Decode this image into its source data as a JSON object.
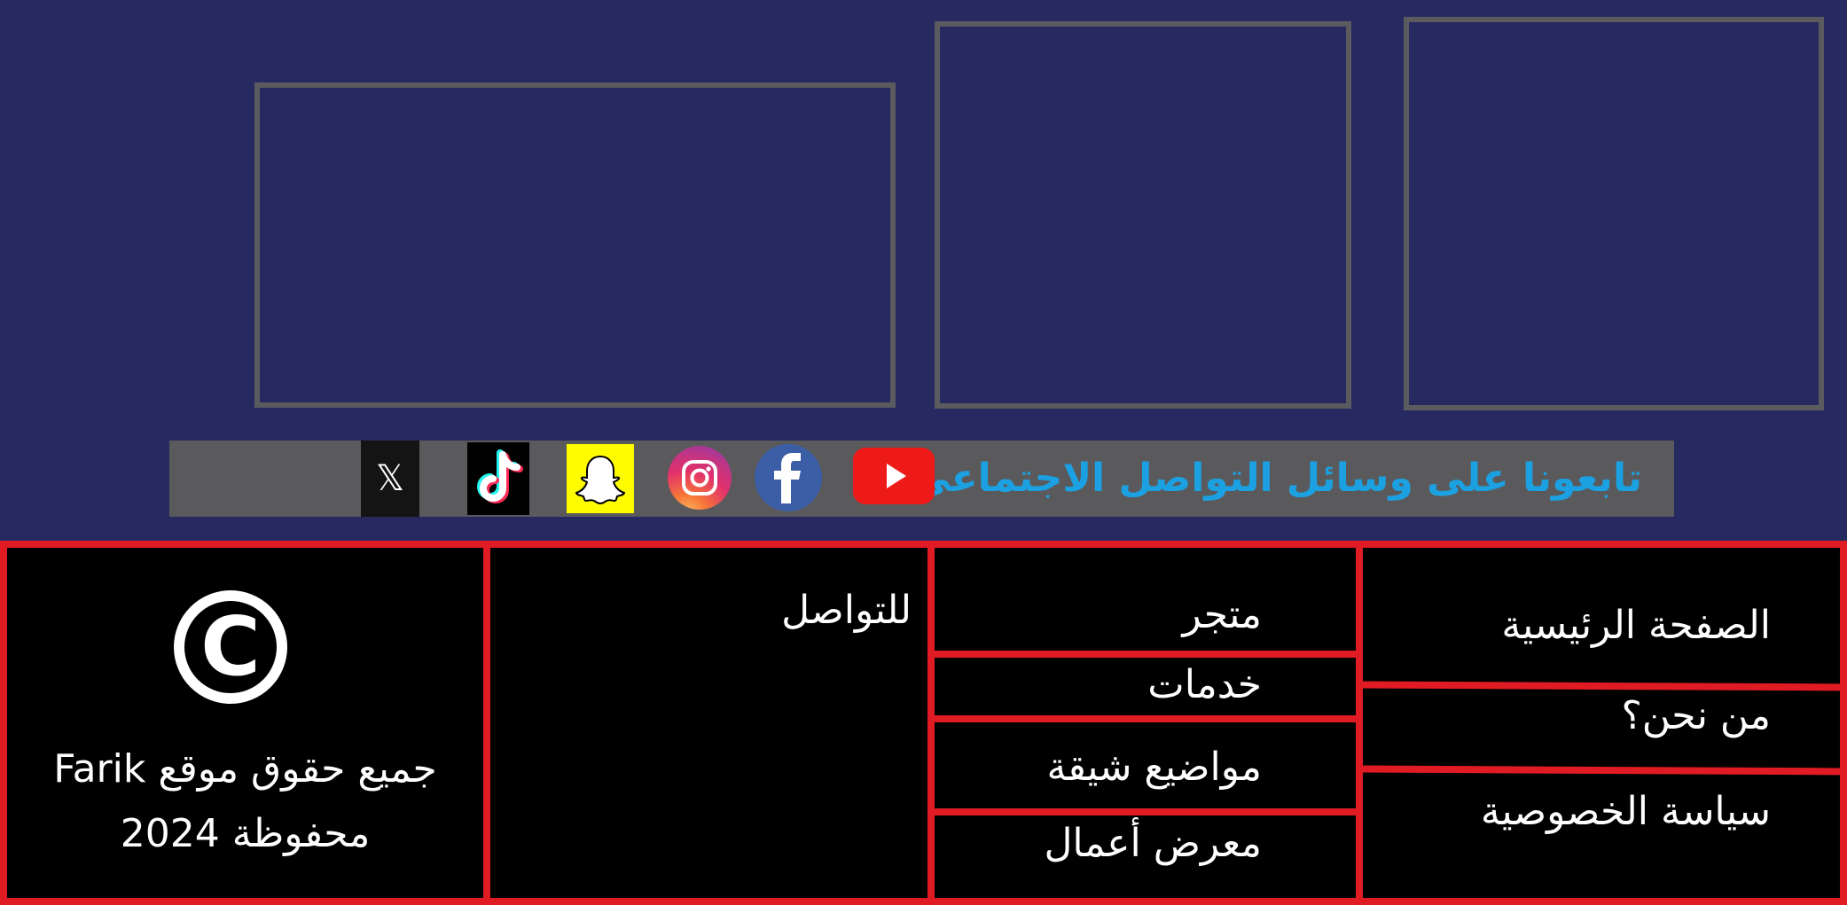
{
  "social": {
    "heading": "تابعونا على وسائل التواصل الاجتماعي",
    "icons": [
      "youtube-icon",
      "facebook-icon",
      "instagram-icon",
      "snapchat-icon",
      "tiktok-icon",
      "x-icon"
    ],
    "x_glyph": "𝕏"
  },
  "footer": {
    "nav_links": [
      "الصفحة الرئيسية",
      "من نحن؟",
      "سياسة الخصوصية"
    ],
    "more_links": [
      "متجر",
      "خدمات",
      "مواضيع شيقة",
      "معرض أعمال"
    ],
    "contact_label": "للتواصل",
    "copyright_line1": "جميع حقوق موقع Farik",
    "copyright_line2": "محفوظة 2024",
    "copyright_symbol": "C"
  },
  "colors": {
    "page_background": "#262a60",
    "placeholder_border": "#5b5b5f",
    "social_bar": "#5a5a5c",
    "social_heading": "#1ba1e2",
    "footer_background": "#000000",
    "footer_grid": "#e11b24",
    "footer_text": "#ffffff"
  }
}
